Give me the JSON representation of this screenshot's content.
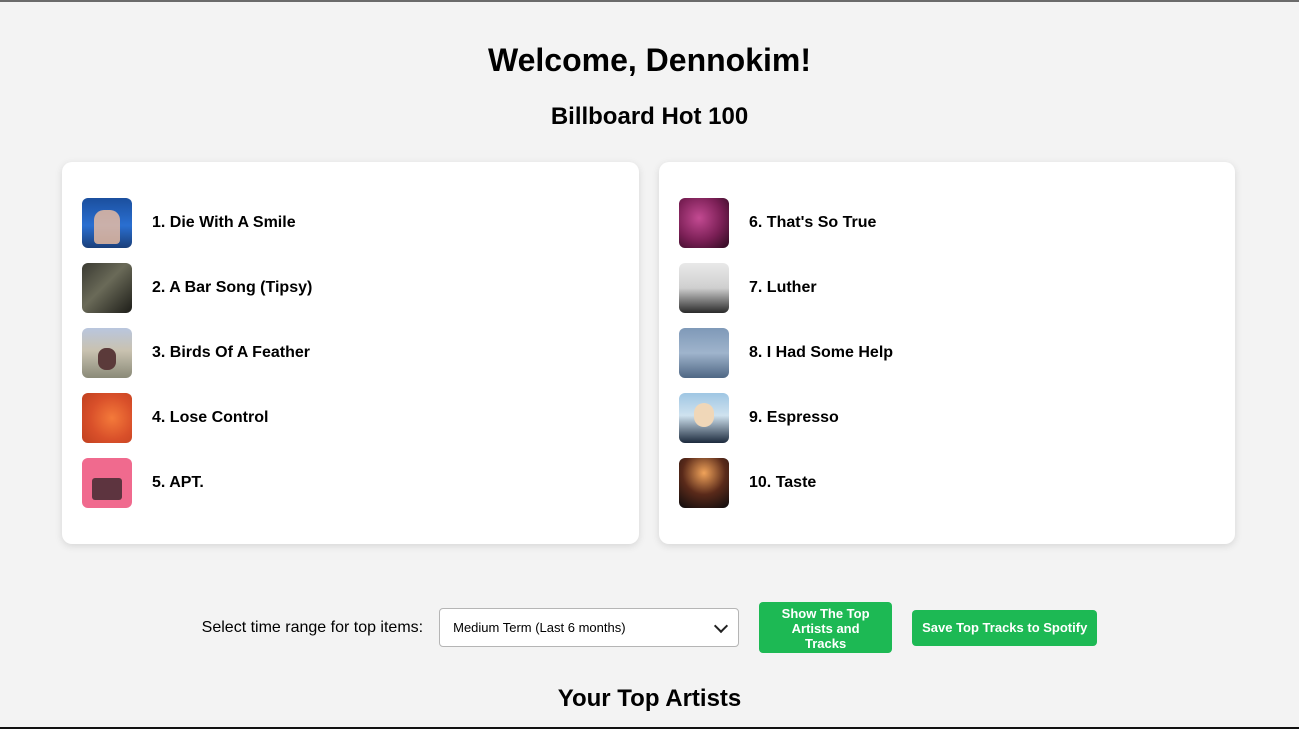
{
  "header": {
    "welcome": "Welcome, Dennokim!",
    "chart_title": "Billboard Hot 100"
  },
  "tracks_left": [
    {
      "label": "1. Die With A Smile",
      "cover": "album-cover"
    },
    {
      "label": "2. A Bar Song (Tipsy)",
      "cover": "album-cover"
    },
    {
      "label": "3. Birds Of A Feather",
      "cover": "album-cover"
    },
    {
      "label": "4. Lose Control",
      "cover": "album-cover"
    },
    {
      "label": "5. APT.",
      "cover": "album-cover"
    }
  ],
  "tracks_right": [
    {
      "label": "6. That's So True",
      "cover": "album-cover"
    },
    {
      "label": "7. Luther",
      "cover": "album-cover"
    },
    {
      "label": "8. I Had Some Help",
      "cover": "album-cover"
    },
    {
      "label": "9. Espresso",
      "cover": "album-cover"
    },
    {
      "label": "10. Taste",
      "cover": "album-cover"
    }
  ],
  "controls": {
    "range_label": "Select time range for top items:",
    "range_selected": "Medium Term (Last 6 months)",
    "show_button_label": "Show The Top Artists and Tracks",
    "save_button_label": "Save Top Tracks to Spotify"
  },
  "sections": {
    "top_artists_title": "Your Top Artists"
  },
  "colors": {
    "accent": "#1db954",
    "background": "#f3f3f3",
    "card": "#ffffff"
  }
}
